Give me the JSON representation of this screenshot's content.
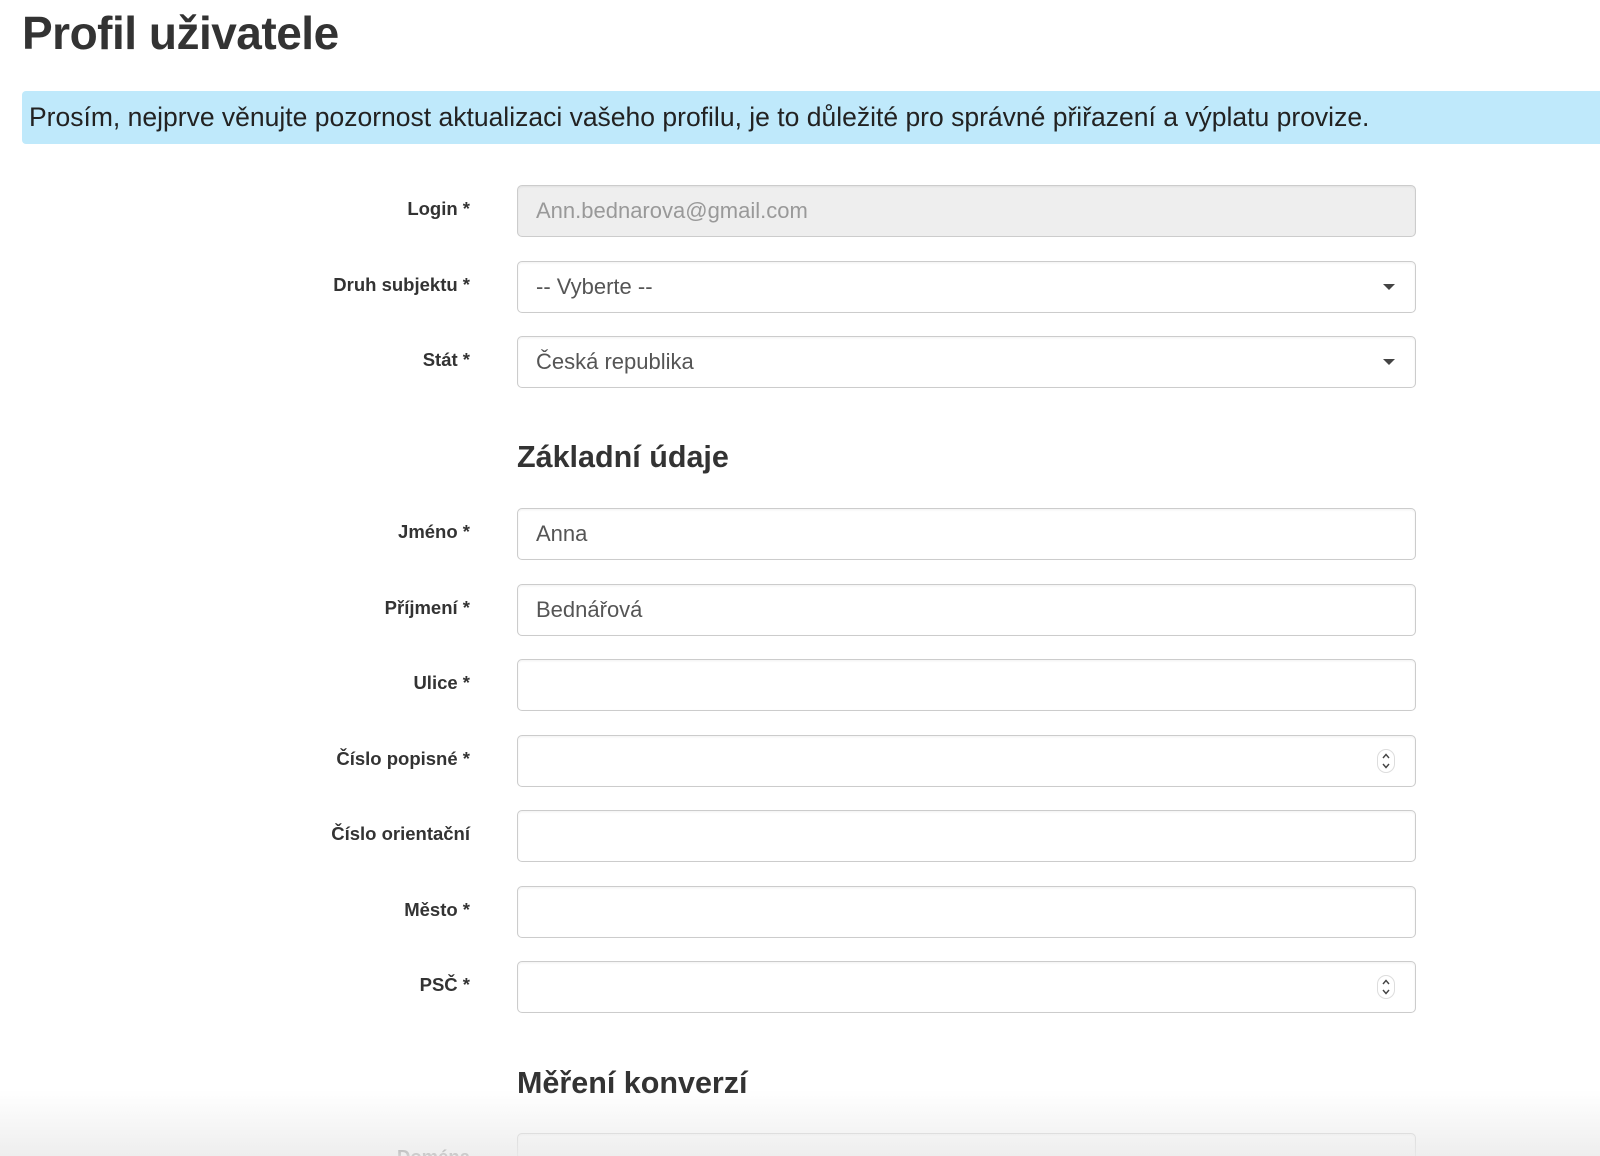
{
  "page": {
    "title": "Profil uživatele"
  },
  "alert": {
    "text": "Prosím, nejprve věnujte pozornost aktualizaci vašeho profilu, je to důležité pro správné přiřazení a výplatu provize.",
    "color": "#bfe9fb"
  },
  "form": {
    "login": {
      "label": "Login *",
      "value": "Ann.bednarova@gmail.com"
    },
    "subject_type": {
      "label": "Druh subjektu *",
      "selected": "-- Vyberte --"
    },
    "country": {
      "label": "Stát *",
      "selected": "Česká republika"
    },
    "basic_section": "Základní údaje",
    "first_name": {
      "label": "Jméno *",
      "value": "Anna"
    },
    "last_name": {
      "label": "Příjmení *",
      "value": "Bednářová"
    },
    "street": {
      "label": "Ulice *",
      "value": ""
    },
    "house_number": {
      "label": "Číslo popisné *",
      "value": ""
    },
    "orientation_number": {
      "label": "Číslo orientační",
      "value": ""
    },
    "city": {
      "label": "Město *",
      "value": ""
    },
    "zip": {
      "label": "PSČ *",
      "value": ""
    },
    "conversion_section": "Měření konverzí",
    "domain": {
      "label": "Doména",
      "value": ""
    }
  }
}
